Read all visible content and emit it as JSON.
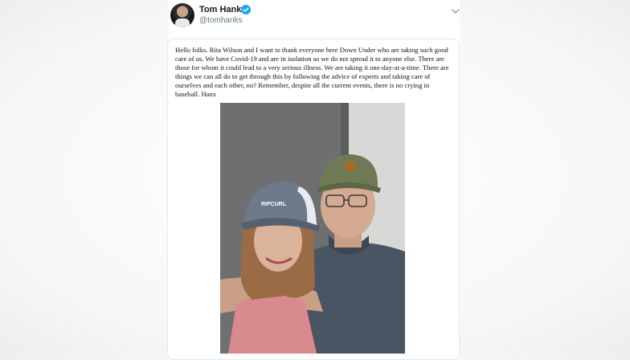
{
  "tweet": {
    "author_name": "Tom Hanks",
    "author_handle": "@tomhanks",
    "verified_icon": "verified-badge-icon",
    "menu_icon": "chevron-down-icon",
    "text": "Hello folks. Rita Wilson and I want to thank everyone here Down Under who are taking such good care of us. We have Covid-19 and are in isolation so we do not spread it to anyone else. There are those for whom it could lead to a very serious illness. We are taking it one-day-at-a-time. There are things we can all do to get through this by following the advice of experts and taking care of ourselves and each other, no? Remember, despite all the current events, there is no crying in baseball. Hanx",
    "photo_cap_text": "RIPCURL"
  },
  "colors": {
    "verified": "#1da1f2",
    "name": "#14171a",
    "handle": "#657786",
    "border": "#e1e8ed"
  }
}
